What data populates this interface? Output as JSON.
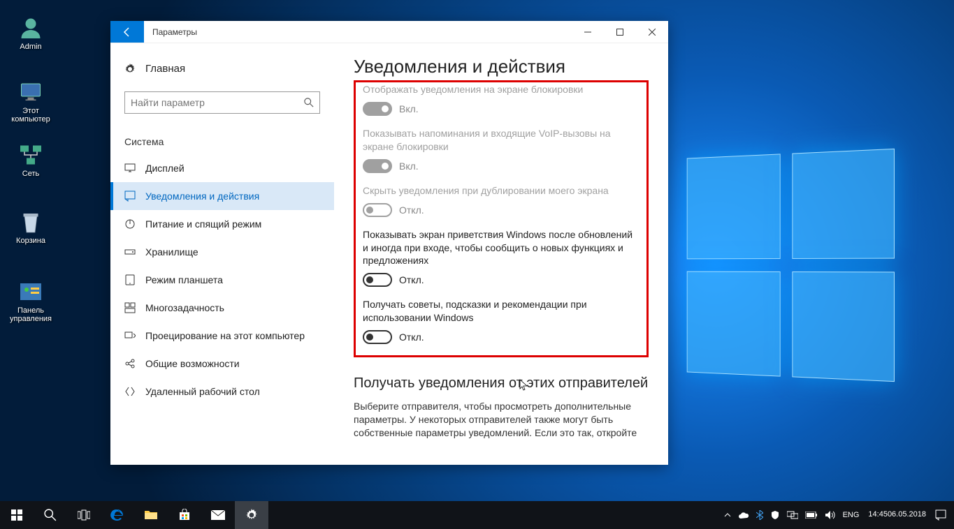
{
  "desktopIcons": [
    {
      "label": "Admin"
    },
    {
      "label": "Этот компьютер"
    },
    {
      "label": "Сеть"
    },
    {
      "label": "Корзина"
    },
    {
      "label": "Панель управления"
    }
  ],
  "window": {
    "title": "Параметры",
    "home": "Главная",
    "searchPlaceholder": "Найти параметр",
    "category": "Система",
    "nav": [
      {
        "label": "Дисплей"
      },
      {
        "label": "Уведомления и действия"
      },
      {
        "label": "Питание и спящий режим"
      },
      {
        "label": "Хранилище"
      },
      {
        "label": "Режим планшета"
      },
      {
        "label": "Многозадачность"
      },
      {
        "label": "Проецирование на этот компьютер"
      },
      {
        "label": "Общие возможности"
      },
      {
        "label": "Удаленный рабочий стол"
      }
    ]
  },
  "content": {
    "heading": "Уведомления и действия",
    "cutoff": "Отображать уведомления на экране блокировки",
    "settings": [
      {
        "label": "",
        "state": "Вкл.",
        "on": true,
        "disabled": true,
        "filled": true
      },
      {
        "label": "Показывать напоминания и входящие VoIP-вызовы на экране блокировки",
        "state": "Вкл.",
        "on": true,
        "disabled": true,
        "filled": true
      },
      {
        "label": "Скрыть уведомления при дублировании моего экрана",
        "state": "Откл.",
        "on": false,
        "disabled": true,
        "filled": false
      },
      {
        "label": "Показывать экран приветствия Windows после обновлений и иногда при входе, чтобы сообщить о новых функциях и предложениях",
        "state": "Откл.",
        "on": false,
        "disabled": false,
        "filled": false
      },
      {
        "label": "Получать советы, подсказки и рекомендации при использовании Windows",
        "state": "Откл.",
        "on": false,
        "disabled": false,
        "filled": false
      }
    ],
    "subheading": "Получать уведомления от этих отправителей",
    "paragraph": "Выберите отправителя, чтобы просмотреть дополнительные параметры. У некоторых отправителей также могут быть собственные параметры уведомлений. Если это так, откройте"
  },
  "tray": {
    "lang": "ENG",
    "time": "14:45",
    "date": "06.05.2018"
  }
}
